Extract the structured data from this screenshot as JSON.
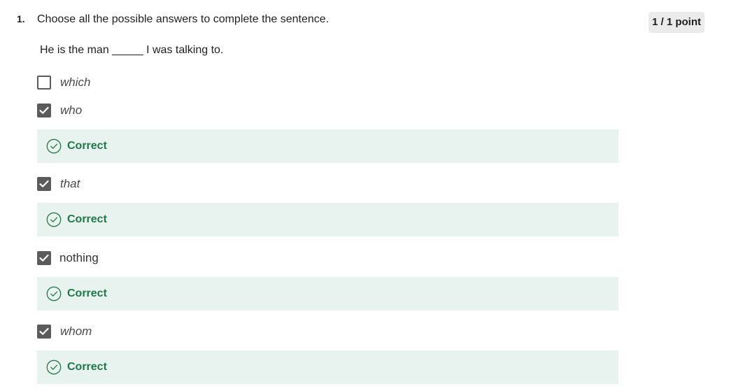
{
  "question": {
    "number": "1.",
    "prompt": "Choose all the possible answers to complete the sentence.",
    "points": "1 / 1 point",
    "sentence": "He is the man _____ I was talking to."
  },
  "options": [
    {
      "label": "which",
      "checked": false,
      "style": "italic",
      "feedback": ""
    },
    {
      "label": "who",
      "checked": true,
      "style": "italic",
      "feedback": "Correct"
    },
    {
      "label": "that",
      "checked": true,
      "style": "italic",
      "feedback": "Correct"
    },
    {
      "label": "nothing",
      "checked": true,
      "style": "plain",
      "feedback": "Correct"
    },
    {
      "label": "whom",
      "checked": true,
      "style": "italic",
      "feedback": "Correct"
    }
  ],
  "icons": {
    "checkbox_checked": "checkmark-icon",
    "feedback_correct": "check-circle-icon"
  },
  "colors": {
    "correct_text": "#1e7a4a",
    "feedback_background": "#e8f2ee",
    "checkbox": "#5b5b5b",
    "points_badge_background": "#ebebeb"
  }
}
